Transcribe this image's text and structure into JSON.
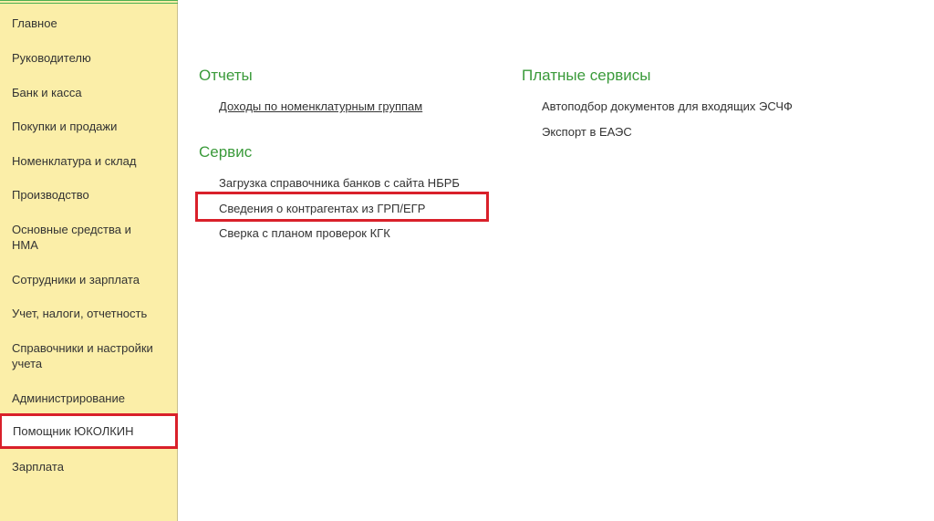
{
  "sidebar": {
    "items": [
      {
        "label": "Главное"
      },
      {
        "label": "Руководителю"
      },
      {
        "label": "Банк и касса"
      },
      {
        "label": "Покупки и продажи"
      },
      {
        "label": "Номенклатура и склад"
      },
      {
        "label": "Производство"
      },
      {
        "label": "Основные средства и НМА"
      },
      {
        "label": "Сотрудники и зарплата"
      },
      {
        "label": "Учет, налоги, отчетность"
      },
      {
        "label": "Справочники и настройки учета"
      },
      {
        "label": "Администрирование"
      },
      {
        "label": "Помощник ЮКОЛКИН",
        "active": true
      },
      {
        "label": "Зарплата"
      }
    ]
  },
  "main": {
    "reports": {
      "title": "Отчеты",
      "items": [
        "Доходы по номенклатурным группам"
      ]
    },
    "service": {
      "title": "Сервис",
      "items": [
        "Загрузка справочника банков с сайта НБРБ",
        "Сведения о контрагентах из ГРП/ЕГР",
        "Сверка с планом проверок КГК"
      ]
    },
    "paid_services": {
      "title": "Платные сервисы",
      "items": [
        "Автоподбор документов для входящих ЭСЧФ",
        "Экспорт в ЕАЭС"
      ]
    }
  },
  "colors": {
    "sidebar_bg": "#fbeea8",
    "section_title": "#3a9a3a",
    "highlight": "#d9202a"
  }
}
